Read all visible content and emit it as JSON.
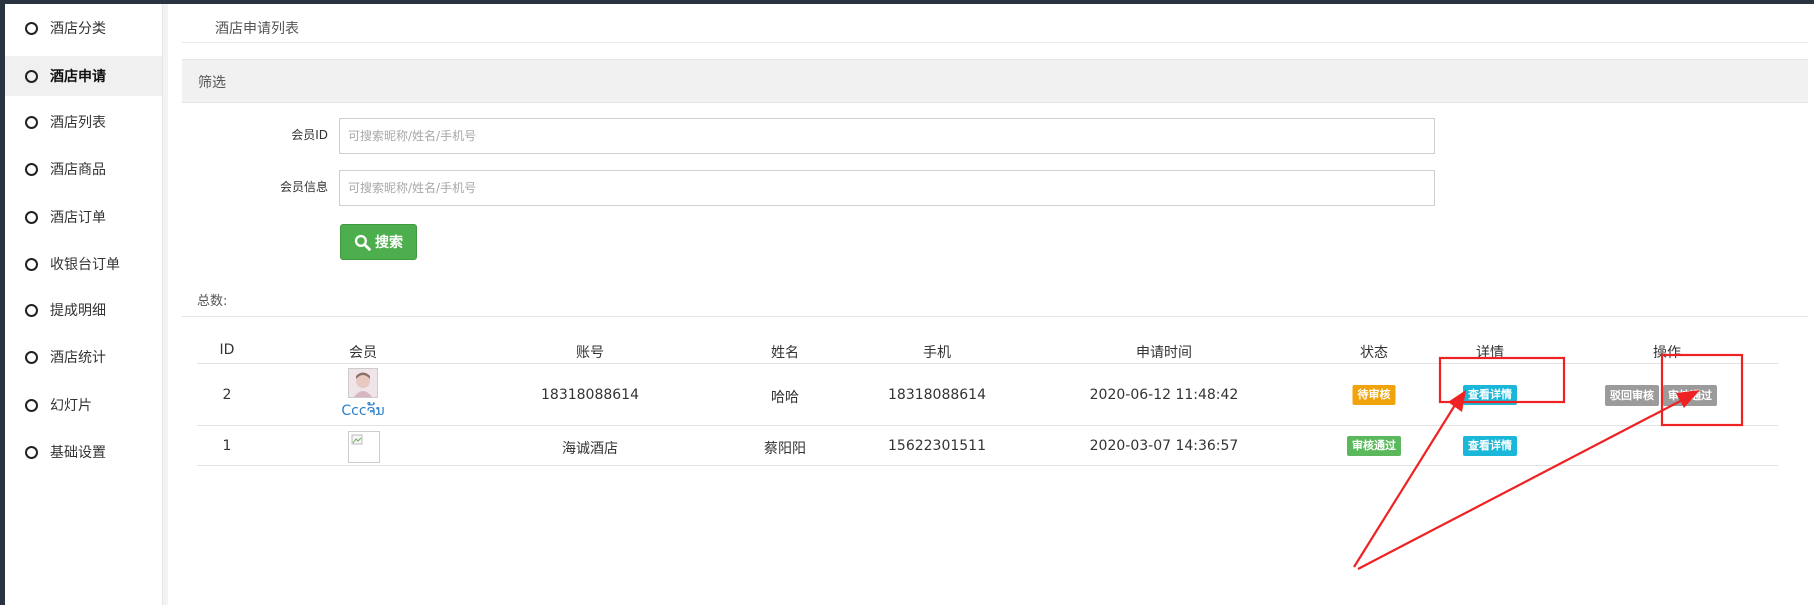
{
  "sidebar": {
    "items": [
      {
        "label": "酒店分类",
        "active": false
      },
      {
        "label": "酒店申请",
        "active": true
      },
      {
        "label": "酒店列表",
        "active": false
      },
      {
        "label": "酒店商品",
        "active": false
      },
      {
        "label": "酒店订单",
        "active": false
      },
      {
        "label": "收银台订单",
        "active": false
      },
      {
        "label": "提成明细",
        "active": false
      },
      {
        "label": "酒店统计",
        "active": false
      },
      {
        "label": "幻灯片",
        "active": false
      },
      {
        "label": "基础设置",
        "active": false
      }
    ]
  },
  "page": {
    "title": "酒店申请列表"
  },
  "filter": {
    "heading": "筛选",
    "member_id_label": "会员ID",
    "member_id_placeholder": "可搜索昵称/姓名/手机号",
    "member_info_label": "会员信息",
    "member_info_placeholder": "可搜索昵称/姓名/手机号",
    "search_label": "搜索"
  },
  "total_label": "总数:",
  "table": {
    "headers": [
      "ID",
      "会员",
      "账号",
      "姓名",
      "手机",
      "申请时间",
      "状态",
      "详情",
      "操作"
    ],
    "rows": [
      {
        "id": "2",
        "member": "Cccຈັນ",
        "account": "18318088614",
        "name": "哈哈",
        "phone": "18318088614",
        "time": "2020-06-12 11:48:42",
        "status": "待审核",
        "detail": "查看详情",
        "reject": "驳回审核",
        "approve": "审核通过"
      },
      {
        "id": "1",
        "member": "",
        "account": "海诚酒店",
        "name": "蔡阳阳",
        "phone": "15622301511",
        "time": "2020-03-07 14:36:57",
        "status": "审核通过",
        "detail": "查看详情"
      }
    ]
  },
  "colors": {
    "pending": "#f0a30a",
    "approved": "#5cb85c",
    "detail": "#1ab7d8",
    "action_gray": "#9b9b9b",
    "search": "#4cae4c",
    "annotation": "#ee2222"
  }
}
